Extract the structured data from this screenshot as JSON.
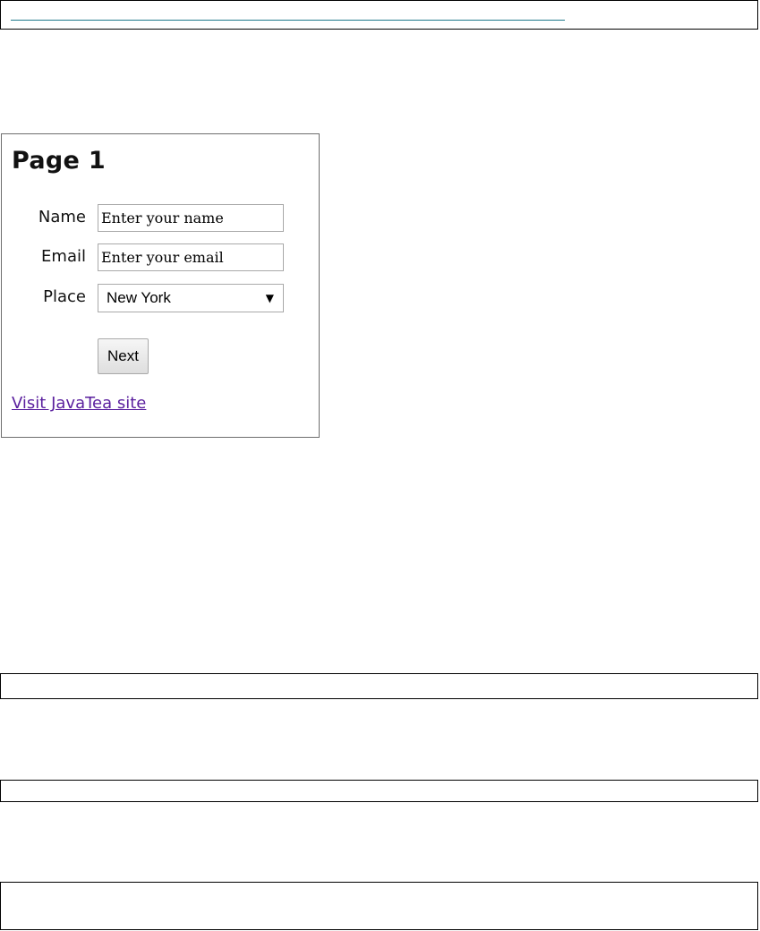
{
  "form": {
    "title": "Page 1",
    "name_label": "Name",
    "name_placeholder": "Enter your name",
    "email_label": "Email",
    "email_placeholder": "Enter your email",
    "place_label": "Place",
    "place_selected": "New York",
    "next_label": "Next",
    "link_text": "Visit JavaTea site"
  },
  "colors": {
    "link": "#5a1f9e",
    "top_link_line": "#1f7a8c",
    "panel_border": "#6e6e6e"
  },
  "icons": {
    "select_arrow": "dropdown-triangle-icon"
  }
}
